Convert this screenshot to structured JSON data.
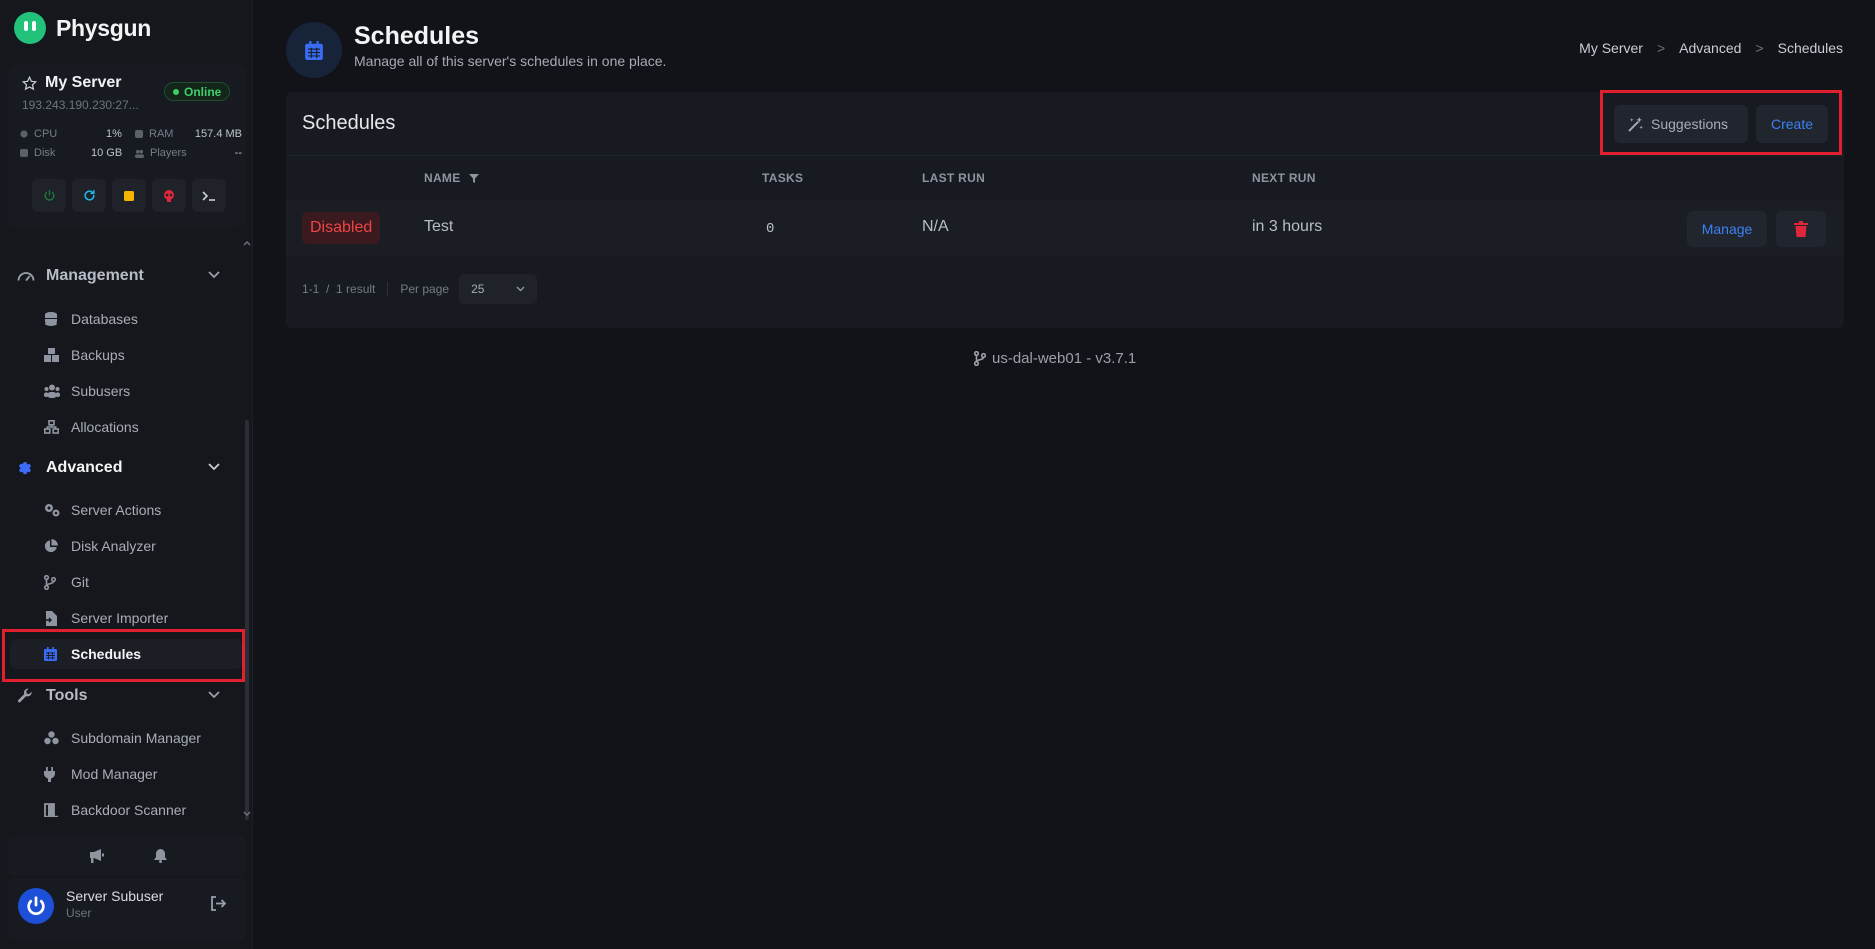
{
  "brand": {
    "name": "Physgun"
  },
  "server": {
    "name": "My Server",
    "status": "Online",
    "ip": "193.243.190.230:27...",
    "cpu_label": "CPU",
    "cpu_value": "1%",
    "ram_label": "RAM",
    "ram_value": "157.4 MB",
    "disk_label": "Disk",
    "disk_value": "10 GB",
    "players_label": "Players",
    "players_value": "--"
  },
  "nav": {
    "management": {
      "label": "Management",
      "items": [
        {
          "label": "Databases",
          "icon": "database-icon"
        },
        {
          "label": "Backups",
          "icon": "boxes-icon"
        },
        {
          "label": "Subusers",
          "icon": "users-icon"
        },
        {
          "label": "Allocations",
          "icon": "network-icon"
        }
      ]
    },
    "advanced": {
      "label": "Advanced",
      "items": [
        {
          "label": "Server Actions",
          "icon": "gears-icon"
        },
        {
          "label": "Disk Analyzer",
          "icon": "pie-chart-icon"
        },
        {
          "label": "Git",
          "icon": "git-branch-icon"
        },
        {
          "label": "Server Importer",
          "icon": "file-import-icon"
        },
        {
          "label": "Schedules",
          "icon": "calendar-icon"
        }
      ]
    },
    "tools": {
      "label": "Tools",
      "items": [
        {
          "label": "Subdomain Manager",
          "icon": "cubes-icon"
        },
        {
          "label": "Mod Manager",
          "icon": "plug-icon"
        },
        {
          "label": "Backdoor Scanner",
          "icon": "door-icon"
        }
      ]
    }
  },
  "user": {
    "name": "Server Subuser",
    "role": "User"
  },
  "header": {
    "title": "Schedules",
    "subtitle": "Manage all of this server's schedules in one place.",
    "breadcrumbs": [
      "My Server",
      "Advanced",
      "Schedules"
    ],
    "breadcrumb_sep": ">"
  },
  "card": {
    "title": "Schedules",
    "suggestions_label": "Suggestions",
    "create_label": "Create",
    "columns": [
      "NAME",
      "TASKS",
      "LAST RUN",
      "NEXT RUN"
    ],
    "rows": [
      {
        "status": "Disabled",
        "name": "Test",
        "tasks": "0",
        "last_run": "N/A",
        "next_run": "in 3 hours",
        "manage_label": "Manage"
      }
    ],
    "pagination": {
      "range": "1-1  /  1 result",
      "per_page_label": "Per page",
      "per_page_value": "25"
    }
  },
  "footer": {
    "version": "us-dal-web01 - v3.7.1"
  },
  "colors": {
    "accent": "#3b82f6",
    "danger": "#ef4444",
    "success": "#3ecf6a",
    "highlight": "#e0202e"
  }
}
